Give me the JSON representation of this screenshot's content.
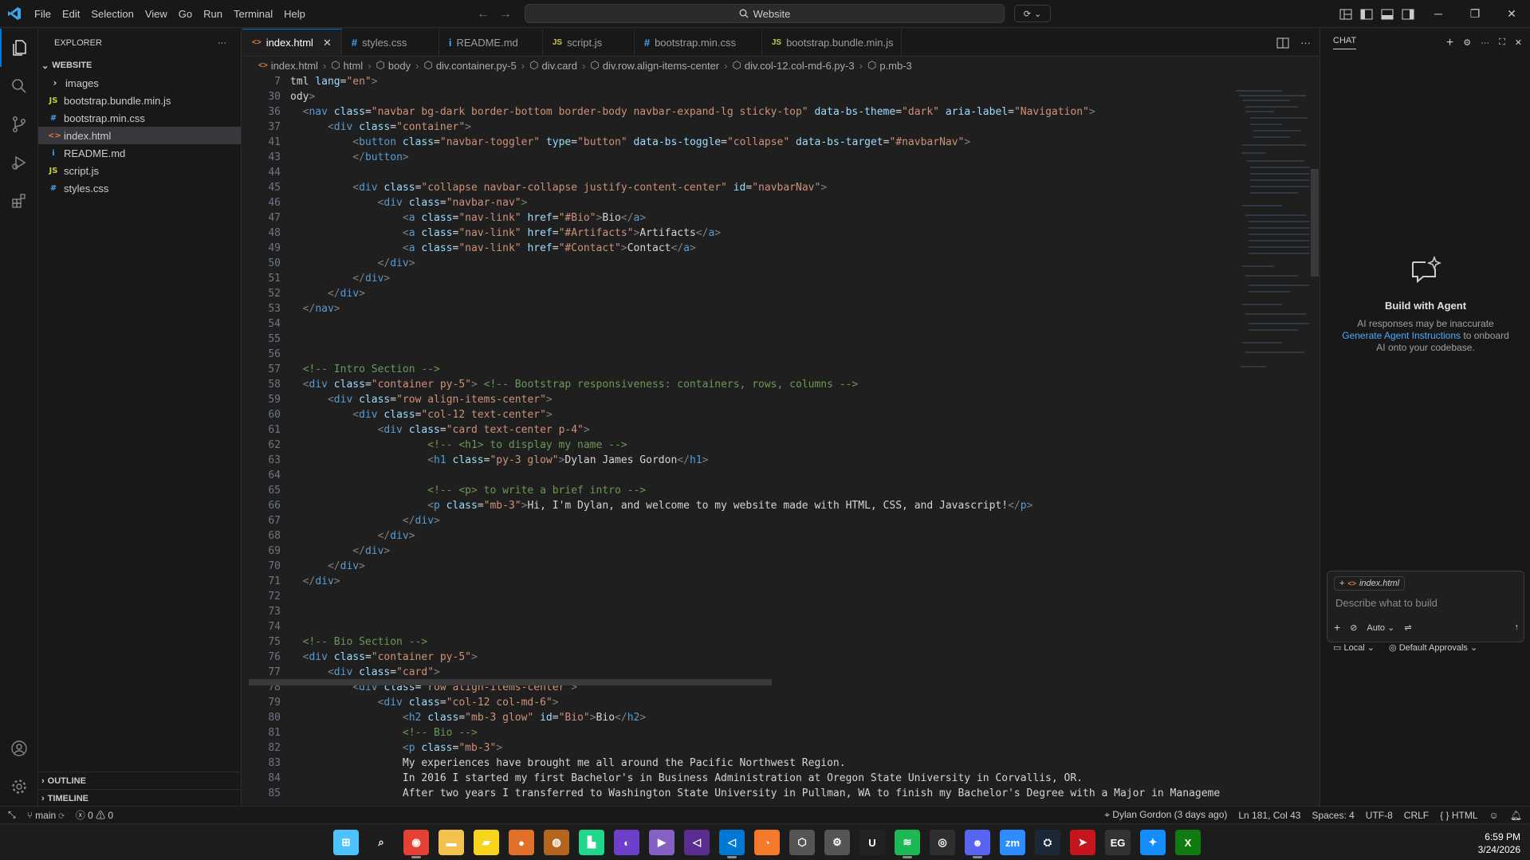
{
  "titlebar": {
    "menu": [
      "File",
      "Edit",
      "Selection",
      "View",
      "Go",
      "Run",
      "Terminal",
      "Help"
    ],
    "search": "Website"
  },
  "explorer": {
    "title": "EXPLORER",
    "folder": "WEBSITE",
    "items": [
      {
        "name": "images",
        "icon": "chevron-right",
        "type": "folder"
      },
      {
        "name": "bootstrap.bundle.min.js",
        "icon": "JS",
        "type": "js"
      },
      {
        "name": "bootstrap.min.css",
        "icon": "#",
        "type": "css"
      },
      {
        "name": "index.html",
        "icon": "<>",
        "type": "html"
      },
      {
        "name": "README.md",
        "icon": "i",
        "type": "md"
      },
      {
        "name": "script.js",
        "icon": "JS",
        "type": "js"
      },
      {
        "name": "styles.css",
        "icon": "#",
        "type": "css"
      }
    ],
    "outline": "OUTLINE",
    "timeline": "TIMELINE"
  },
  "tabs": [
    {
      "label": "index.html",
      "icon": "<>"
    },
    {
      "label": "styles.css",
      "icon": "#"
    },
    {
      "label": "README.md",
      "icon": "i"
    },
    {
      "label": "script.js",
      "icon": "JS"
    },
    {
      "label": "bootstrap.min.css",
      "icon": "#"
    },
    {
      "label": "bootstrap.bundle.min.js",
      "icon": "JS"
    }
  ],
  "breadcrumb": [
    "index.html",
    "html",
    "body",
    "div.container.py-5",
    "div.card",
    "div.row.align-items-center",
    "div.col-12.col-md-6.py-3",
    "p.mb-3"
  ],
  "code_lines": [
    {
      "n": "7",
      "text": "tml lang=\"en\">"
    },
    {
      "n": "30",
      "text": "ody>"
    },
    {
      "n": "36",
      "text": "  <nav class=\"navbar bg-dark border-bottom border-body navbar-expand-lg sticky-top\" data-bs-theme=\"dark\" aria-label=\"Navigation\">"
    },
    {
      "n": "37",
      "text": "      <div class=\"container\">"
    },
    {
      "n": "41",
      "text": "          <button class=\"navbar-toggler\" type=\"button\" data-bs-toggle=\"collapse\" data-bs-target=\"#navbarNav\">"
    },
    {
      "n": "43",
      "text": "          </button>"
    },
    {
      "n": "44",
      "text": ""
    },
    {
      "n": "45",
      "text": "          <div class=\"collapse navbar-collapse justify-content-center\" id=\"navbarNav\">"
    },
    {
      "n": "46",
      "text": "              <div class=\"navbar-nav\">"
    },
    {
      "n": "47",
      "text": "                  <a class=\"nav-link\" href=\"#Bio\">Bio</a>"
    },
    {
      "n": "48",
      "text": "                  <a class=\"nav-link\" href=\"#Artifacts\">Artifacts</a>"
    },
    {
      "n": "49",
      "text": "                  <a class=\"nav-link\" href=\"#Contact\">Contact</a>"
    },
    {
      "n": "50",
      "text": "              </div>"
    },
    {
      "n": "51",
      "text": "          </div>"
    },
    {
      "n": "52",
      "text": "      </div>"
    },
    {
      "n": "53",
      "text": "  </nav>"
    },
    {
      "n": "54",
      "text": ""
    },
    {
      "n": "55",
      "text": ""
    },
    {
      "n": "56",
      "text": ""
    },
    {
      "n": "57",
      "text": "  <!-- Intro Section -->"
    },
    {
      "n": "58",
      "text": "  <div class=\"container py-5\"> <!-- Bootstrap responsiveness: containers, rows, columns -->"
    },
    {
      "n": "59",
      "text": "      <div class=\"row align-items-center\">"
    },
    {
      "n": "60",
      "text": "          <div class=\"col-12 text-center\">"
    },
    {
      "n": "61",
      "text": "              <div class=\"card text-center p-4\">"
    },
    {
      "n": "62",
      "text": "                      <!-- <h1> to display my name -->"
    },
    {
      "n": "63",
      "text": "                      <h1 class=\"py-3 glow\">Dylan James Gordon</h1>"
    },
    {
      "n": "64",
      "text": ""
    },
    {
      "n": "65",
      "text": "                      <!-- <p> to write a brief intro -->"
    },
    {
      "n": "66",
      "text": "                      <p class=\"mb-3\">Hi, I'm Dylan, and welcome to my website made with HTML, CSS, and Javascript!</p>"
    },
    {
      "n": "67",
      "text": "                  </div>"
    },
    {
      "n": "68",
      "text": "              </div>"
    },
    {
      "n": "69",
      "text": "          </div>"
    },
    {
      "n": "70",
      "text": "      </div>"
    },
    {
      "n": "71",
      "text": "  </div>"
    },
    {
      "n": "72",
      "text": ""
    },
    {
      "n": "73",
      "text": ""
    },
    {
      "n": "74",
      "text": ""
    },
    {
      "n": "75",
      "text": "  <!-- Bio Section -->"
    },
    {
      "n": "76",
      "text": "  <div class=\"container py-5\">"
    },
    {
      "n": "77",
      "text": "      <div class=\"card\">"
    },
    {
      "n": "78",
      "text": "          <div class=\"row align-items-center\">"
    },
    {
      "n": "79",
      "text": "              <div class=\"col-12 col-md-6\">"
    },
    {
      "n": "80",
      "text": "                  <h2 class=\"mb-3 glow\" id=\"Bio\">Bio</h2>"
    },
    {
      "n": "81",
      "text": "                  <!-- Bio -->"
    },
    {
      "n": "82",
      "text": "                  <p class=\"mb-3\">"
    },
    {
      "n": "83",
      "text": "                  My experiences have brought me all around the Pacific Northwest Region."
    },
    {
      "n": "84",
      "text": "                  In 2016 I started my first Bachelor's in Business Administration at Oregon State University in Corvallis, OR."
    },
    {
      "n": "85",
      "text": "                  After two years I transferred to Washington State University in Pullman, WA to finish my Bachelor's Degree with a Major in Manageme"
    }
  ],
  "chat": {
    "title": "CHAT",
    "heading": "Build with Agent",
    "desc1": "AI responses may be inaccurate",
    "link": "Generate Agent Instructions",
    "desc2": "to onboard",
    "desc3": "AI onto your codebase.",
    "context_file": "index.html",
    "placeholder": "Describe what to build",
    "mode": "Auto",
    "location": "Local",
    "approvals": "Default Approvals"
  },
  "status": {
    "branch": "main",
    "errors": "0",
    "warnings": "0",
    "blame": "Dylan Gordon (3 days ago)",
    "position": "Ln 181, Col 43",
    "spaces": "Spaces: 4",
    "encoding": "UTF-8",
    "eol": "CRLF",
    "language": "HTML"
  },
  "taskbar": {
    "apps": [
      "start",
      "search",
      "chrome",
      "file-explorer",
      "sticky-notes",
      "basketball",
      "game",
      "pycharm",
      "github",
      "visual-studio-purple",
      "visual-studio",
      "vscode",
      "blender",
      "unity",
      "settings",
      "unreal",
      "spotify",
      "obs",
      "discord",
      "zoom",
      "steam",
      "arrow",
      "epic-games",
      "battlenet",
      "xbox"
    ],
    "time": "6:59 PM",
    "date": "3/24/2026"
  },
  "colors": {
    "accent": "#0078d4",
    "tag": "#569cd6",
    "attr": "#9cdcfe",
    "value": "#ce9178",
    "comment": "#6a9955"
  }
}
